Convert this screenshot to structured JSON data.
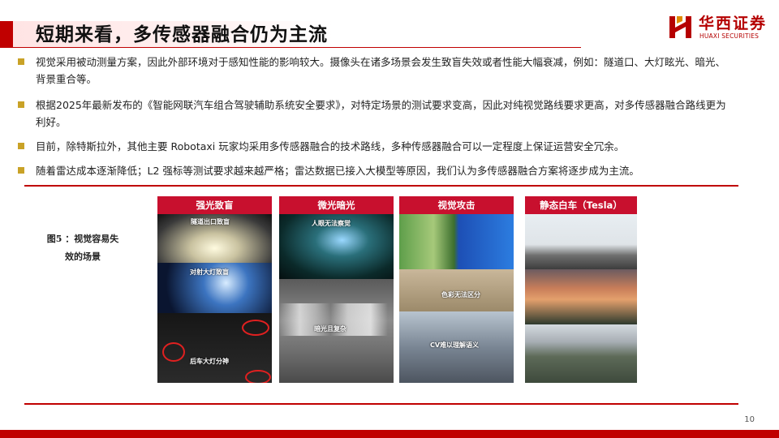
{
  "header": {
    "title": "短期来看，多传感器融合仍为主流"
  },
  "logo": {
    "cn": "华西证券",
    "en": "HUAXI SECURITIES"
  },
  "bullets": [
    "视觉采用被动测量方案，因此外部环境对于感知性能的影响较大。摄像头在诸多场景会发生致盲失效或者性能大幅衰减，例如：隧道口、大灯眩光、暗光、背景重合等。",
    "根据2025年最新发布的《智能网联汽车组合驾驶辅助系统安全要求》，对特定场景的测试要求变高，因此对纯视觉路线要求更高，对多传感器融合路线更为利好。",
    "目前，除特斯拉外，其他主要 Robotaxi 玩家均采用多传感器融合的技术路线，多种传感器融合可以一定程度上保证运营安全冗余。",
    "随着雷达成本逐渐降低；L2 强标等测试要求越来越严格；雷达数据已接入大模型等原因，我们认为多传感器融合方案将逐步成为主流。"
  ],
  "figure": {
    "caption_line1": "图5 ：视觉容易失",
    "caption_line2": "效的场景",
    "panels": [
      {
        "title": "强光致盲",
        "labels": [
          "隧道出口致盲",
          "对射大灯致盲",
          "后车大灯分神"
        ]
      },
      {
        "title": "微光暗光",
        "labels": [
          "人眼无法察觉",
          "暗光且复杂"
        ]
      },
      {
        "title": "视觉攻击",
        "labels": [
          "色彩无法区分",
          "CV难以理解语义"
        ]
      },
      {
        "title": "静态白车（Tesla）",
        "labels": []
      }
    ]
  },
  "colors": {
    "brand_red": "#c00000",
    "bullet_gold": "#c9a227",
    "panel_title_red": "#c8102e"
  },
  "footer": {
    "page_number": "10"
  }
}
